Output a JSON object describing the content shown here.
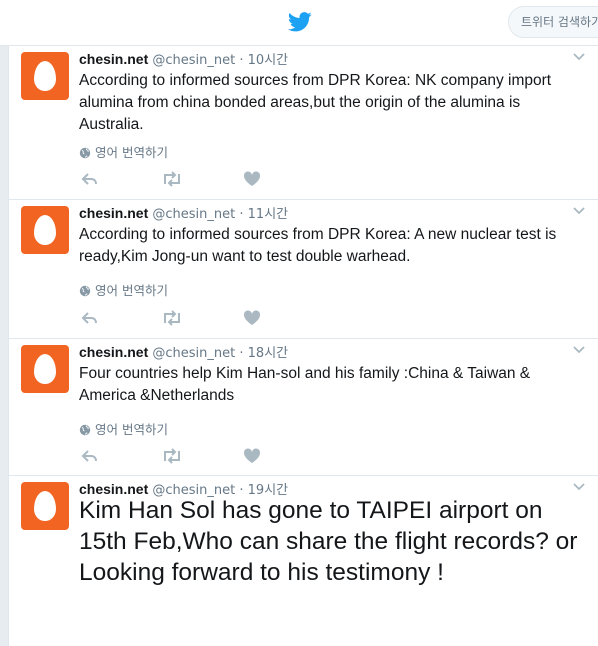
{
  "search": {
    "placeholder": "트위터 검색하기"
  },
  "colors": {
    "brand": "#1da1f2",
    "avatar": "#f26422",
    "meta": "#657786",
    "icon": "#aab8c2"
  },
  "tweets": [
    {
      "name": "chesin.net",
      "handle": "@chesin_net",
      "dot": "·",
      "time": "10시간",
      "text": "According to informed sources from DPR Korea: NK company import alumina from china bonded areas,but the origin of the alumina is Australia.",
      "translate": "영어 번역하기"
    },
    {
      "name": "chesin.net",
      "handle": "@chesin_net",
      "dot": "·",
      "time": "11시간",
      "text": "According to informed sources from DPR Korea: A new nuclear test is ready,Kim Jong-un want to test double warhead.",
      "translate": "영어 번역하기"
    },
    {
      "name": "chesin.net",
      "handle": "@chesin_net",
      "dot": "·",
      "time": "18시간",
      "text": "Four countries help Kim Han-sol and his family :China & Taiwan & America &Netherlands",
      "translate": "영어 번역하기"
    },
    {
      "name": "chesin.net",
      "handle": "@chesin_net",
      "dot": "·",
      "time": "19시간",
      "text": "Kim Han Sol has gone to TAIPEI airport on 15th Feb,Who can share the flight records? or Looking forward to his testimony !"
    }
  ]
}
